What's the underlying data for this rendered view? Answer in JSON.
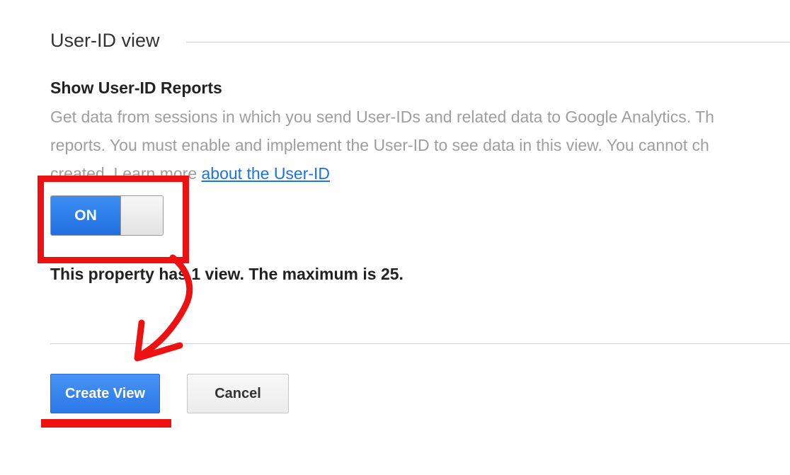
{
  "section": {
    "title": "User-ID view"
  },
  "user_id_setting": {
    "label": "Show User-ID Reports",
    "description_line1": "Get data from sessions in which you send User-IDs and related data to Google Analytics. Th",
    "description_line2": "reports. You must enable and implement the User-ID to see data in this view. You cannot ch",
    "description_line3_prefix": "created. Learn more ",
    "learn_more_link": "about the User-ID",
    "toggle_label": "ON",
    "toggle_state": "on"
  },
  "property_info": {
    "view_count_text": "This property has 1 view. The maximum is 25."
  },
  "actions": {
    "create_label": "Create View",
    "cancel_label": "Cancel"
  },
  "colors": {
    "primary_blue": "#2b78e8",
    "link_blue": "#1a73e8",
    "annotation_red": "#ee1111",
    "muted_text": "#9e9e9e"
  }
}
